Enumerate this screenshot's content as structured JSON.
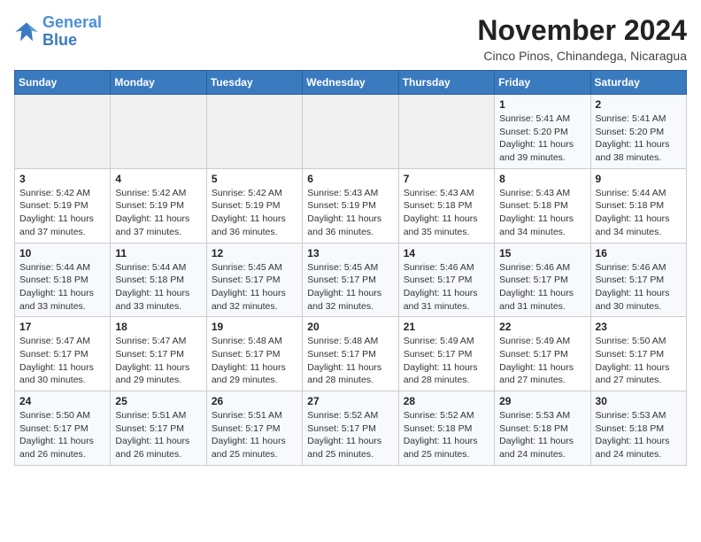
{
  "header": {
    "logo_line1": "General",
    "logo_line2": "Blue",
    "month_title": "November 2024",
    "location": "Cinco Pinos, Chinandega, Nicaragua"
  },
  "weekdays": [
    "Sunday",
    "Monday",
    "Tuesday",
    "Wednesday",
    "Thursday",
    "Friday",
    "Saturday"
  ],
  "weeks": [
    [
      {
        "day": "",
        "info": ""
      },
      {
        "day": "",
        "info": ""
      },
      {
        "day": "",
        "info": ""
      },
      {
        "day": "",
        "info": ""
      },
      {
        "day": "",
        "info": ""
      },
      {
        "day": "1",
        "info": "Sunrise: 5:41 AM\nSunset: 5:20 PM\nDaylight: 11 hours\nand 39 minutes."
      },
      {
        "day": "2",
        "info": "Sunrise: 5:41 AM\nSunset: 5:20 PM\nDaylight: 11 hours\nand 38 minutes."
      }
    ],
    [
      {
        "day": "3",
        "info": "Sunrise: 5:42 AM\nSunset: 5:19 PM\nDaylight: 11 hours\nand 37 minutes."
      },
      {
        "day": "4",
        "info": "Sunrise: 5:42 AM\nSunset: 5:19 PM\nDaylight: 11 hours\nand 37 minutes."
      },
      {
        "day": "5",
        "info": "Sunrise: 5:42 AM\nSunset: 5:19 PM\nDaylight: 11 hours\nand 36 minutes."
      },
      {
        "day": "6",
        "info": "Sunrise: 5:43 AM\nSunset: 5:19 PM\nDaylight: 11 hours\nand 36 minutes."
      },
      {
        "day": "7",
        "info": "Sunrise: 5:43 AM\nSunset: 5:18 PM\nDaylight: 11 hours\nand 35 minutes."
      },
      {
        "day": "8",
        "info": "Sunrise: 5:43 AM\nSunset: 5:18 PM\nDaylight: 11 hours\nand 34 minutes."
      },
      {
        "day": "9",
        "info": "Sunrise: 5:44 AM\nSunset: 5:18 PM\nDaylight: 11 hours\nand 34 minutes."
      }
    ],
    [
      {
        "day": "10",
        "info": "Sunrise: 5:44 AM\nSunset: 5:18 PM\nDaylight: 11 hours\nand 33 minutes."
      },
      {
        "day": "11",
        "info": "Sunrise: 5:44 AM\nSunset: 5:18 PM\nDaylight: 11 hours\nand 33 minutes."
      },
      {
        "day": "12",
        "info": "Sunrise: 5:45 AM\nSunset: 5:17 PM\nDaylight: 11 hours\nand 32 minutes."
      },
      {
        "day": "13",
        "info": "Sunrise: 5:45 AM\nSunset: 5:17 PM\nDaylight: 11 hours\nand 32 minutes."
      },
      {
        "day": "14",
        "info": "Sunrise: 5:46 AM\nSunset: 5:17 PM\nDaylight: 11 hours\nand 31 minutes."
      },
      {
        "day": "15",
        "info": "Sunrise: 5:46 AM\nSunset: 5:17 PM\nDaylight: 11 hours\nand 31 minutes."
      },
      {
        "day": "16",
        "info": "Sunrise: 5:46 AM\nSunset: 5:17 PM\nDaylight: 11 hours\nand 30 minutes."
      }
    ],
    [
      {
        "day": "17",
        "info": "Sunrise: 5:47 AM\nSunset: 5:17 PM\nDaylight: 11 hours\nand 30 minutes."
      },
      {
        "day": "18",
        "info": "Sunrise: 5:47 AM\nSunset: 5:17 PM\nDaylight: 11 hours\nand 29 minutes."
      },
      {
        "day": "19",
        "info": "Sunrise: 5:48 AM\nSunset: 5:17 PM\nDaylight: 11 hours\nand 29 minutes."
      },
      {
        "day": "20",
        "info": "Sunrise: 5:48 AM\nSunset: 5:17 PM\nDaylight: 11 hours\nand 28 minutes."
      },
      {
        "day": "21",
        "info": "Sunrise: 5:49 AM\nSunset: 5:17 PM\nDaylight: 11 hours\nand 28 minutes."
      },
      {
        "day": "22",
        "info": "Sunrise: 5:49 AM\nSunset: 5:17 PM\nDaylight: 11 hours\nand 27 minutes."
      },
      {
        "day": "23",
        "info": "Sunrise: 5:50 AM\nSunset: 5:17 PM\nDaylight: 11 hours\nand 27 minutes."
      }
    ],
    [
      {
        "day": "24",
        "info": "Sunrise: 5:50 AM\nSunset: 5:17 PM\nDaylight: 11 hours\nand 26 minutes."
      },
      {
        "day": "25",
        "info": "Sunrise: 5:51 AM\nSunset: 5:17 PM\nDaylight: 11 hours\nand 26 minutes."
      },
      {
        "day": "26",
        "info": "Sunrise: 5:51 AM\nSunset: 5:17 PM\nDaylight: 11 hours\nand 25 minutes."
      },
      {
        "day": "27",
        "info": "Sunrise: 5:52 AM\nSunset: 5:17 PM\nDaylight: 11 hours\nand 25 minutes."
      },
      {
        "day": "28",
        "info": "Sunrise: 5:52 AM\nSunset: 5:18 PM\nDaylight: 11 hours\nand 25 minutes."
      },
      {
        "day": "29",
        "info": "Sunrise: 5:53 AM\nSunset: 5:18 PM\nDaylight: 11 hours\nand 24 minutes."
      },
      {
        "day": "30",
        "info": "Sunrise: 5:53 AM\nSunset: 5:18 PM\nDaylight: 11 hours\nand 24 minutes."
      }
    ]
  ]
}
